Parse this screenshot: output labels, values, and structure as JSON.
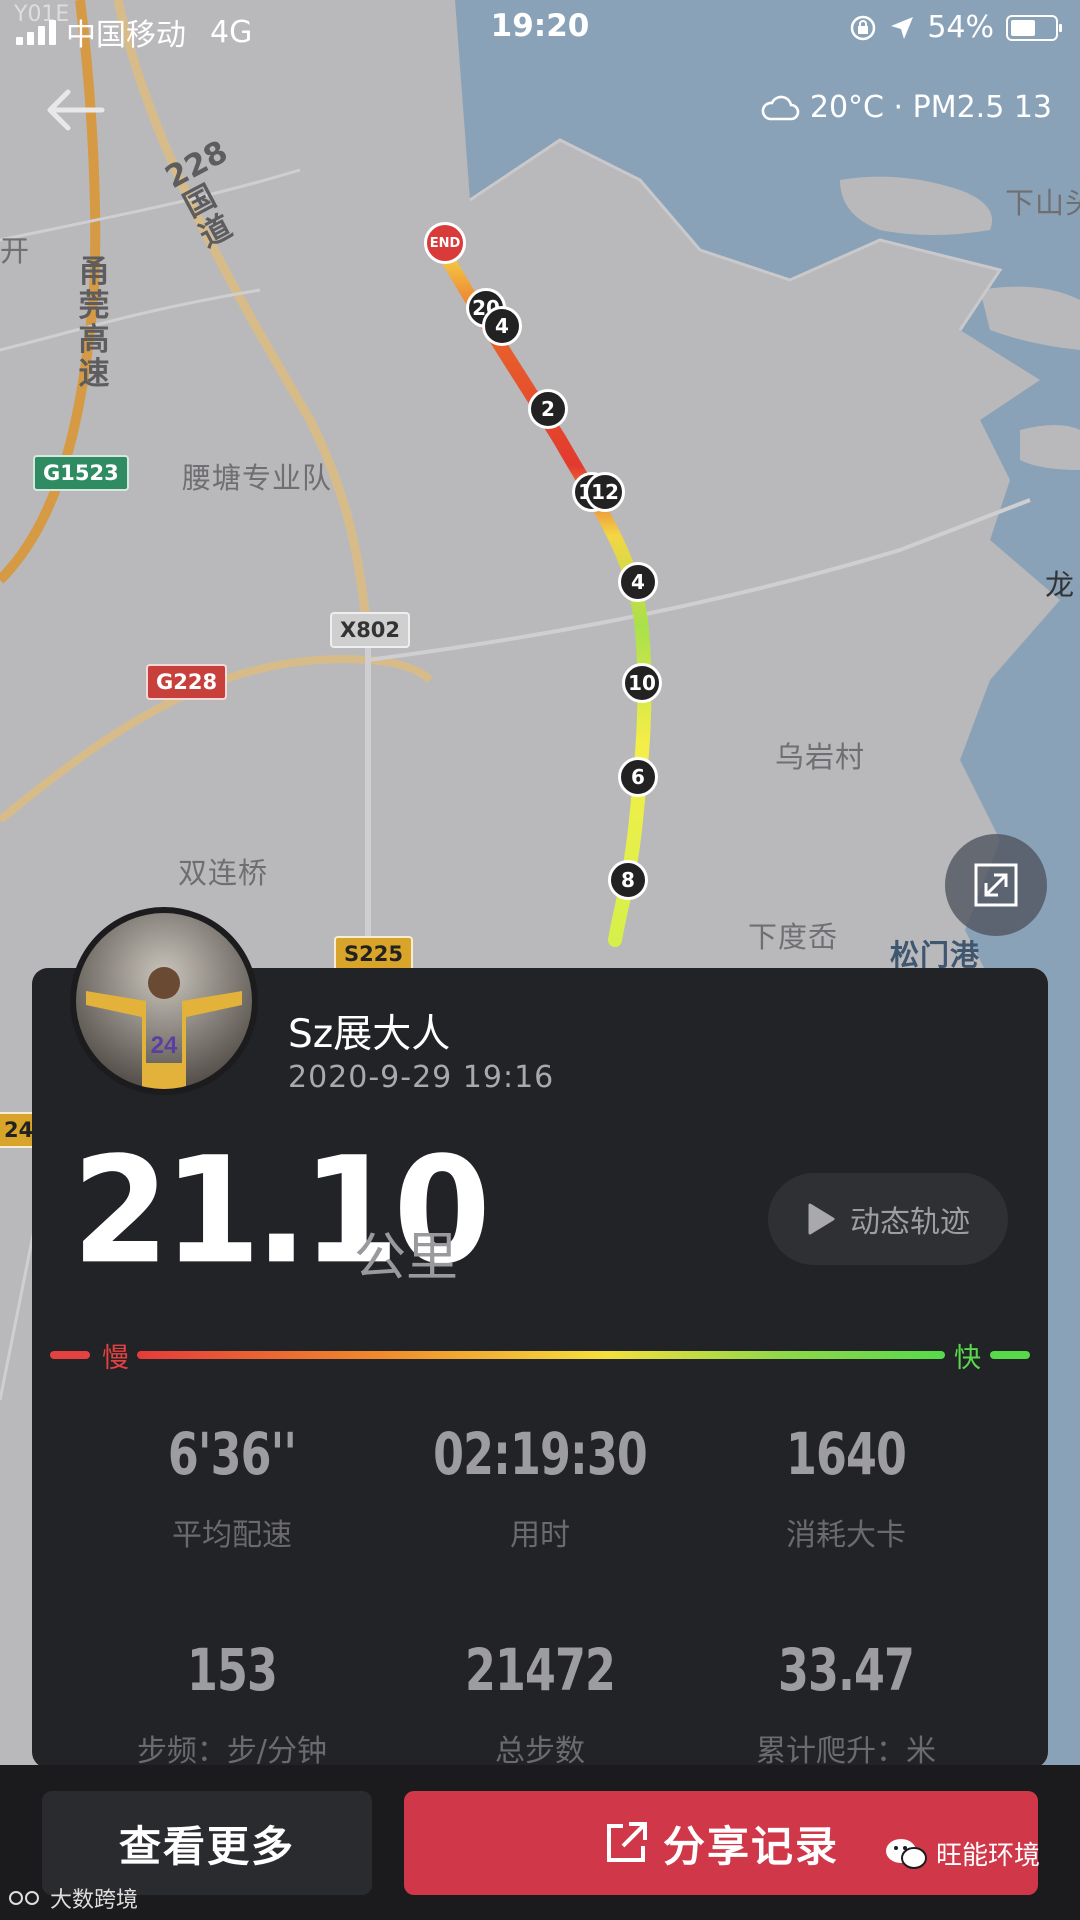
{
  "status_bar": {
    "carrier": "中国移动",
    "network": "4G",
    "time": "19:20",
    "battery": "54%",
    "corner_label": "Y01E"
  },
  "weather": {
    "text": "20°C · PM2.5 13"
  },
  "map": {
    "labels": {
      "yaotang": "腰塘专业队",
      "shuanglian": "双连桥",
      "wuyan": "乌岩村",
      "xiadu": "下度岙",
      "songmen": "松门港",
      "xiashan": "下山头",
      "long": "龙",
      "kai": "开"
    },
    "vertical_labels": {
      "expressway": "甬莞高速",
      "national": "228国道"
    },
    "road_badges": {
      "g1523": "G1523",
      "g228": "G228",
      "x802": "X802",
      "s225": "S225",
      "edge_24": "24"
    },
    "markers": [
      "END",
      "20",
      "4",
      "2",
      "18",
      "12",
      "4",
      "10",
      "6",
      "8"
    ]
  },
  "card": {
    "username": "Sz展大人",
    "datetime": "2020-9-29 19:16",
    "distance": "21.10",
    "unit": "公里",
    "replay_label": "动态轨迹",
    "slow_label": "慢",
    "fast_label": "快",
    "stats": [
      {
        "value": "6'36''",
        "label": "平均配速"
      },
      {
        "value": "02:19:30",
        "label": "用时"
      },
      {
        "value": "1640",
        "label": "消耗大卡"
      },
      {
        "value": "153",
        "label": "步频：步/分钟"
      },
      {
        "value": "21472",
        "label": "总步数"
      },
      {
        "value": "33.47",
        "label": "累计爬升：米"
      }
    ]
  },
  "bottom": {
    "more_label": "查看更多",
    "share_label": "分享记录",
    "watermark_left": "大数跨境",
    "watermark_right": "旺能环境"
  },
  "colors": {
    "accent_red": "#d0384a",
    "card_bg": "#222327",
    "sea": "#8aa2b8",
    "land": "#b9b9bb"
  }
}
